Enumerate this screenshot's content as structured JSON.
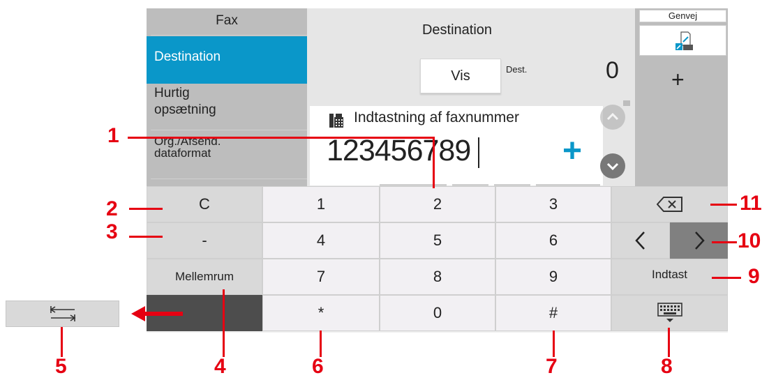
{
  "left_menu": {
    "title": "Fax",
    "items": [
      {
        "label": "Destination",
        "selected": true
      },
      {
        "label_line1": "Hurtig",
        "label_line2": "opsætning"
      },
      {
        "label_line1": "Org./Afsend.",
        "label_line2": "dataformat"
      }
    ]
  },
  "center": {
    "title": "Destination",
    "vis_button": "Vis",
    "dest_label": "Dest.",
    "dest_count": "0",
    "input_label": "Indtastning af faxnummer",
    "fax_number": "123456789",
    "add_symbol": "+"
  },
  "right": {
    "shortcut_label": "Genvej",
    "add_symbol": "+"
  },
  "keyboard": {
    "row1": [
      "C",
      "1",
      "2",
      "3"
    ],
    "row2": [
      "-",
      "4",
      "5",
      "6"
    ],
    "row3": [
      "Mellemrum",
      "7",
      "8",
      "9",
      "Indtast"
    ],
    "row4": [
      "*",
      "0",
      "#"
    ]
  },
  "callouts": [
    "1",
    "2",
    "3",
    "4",
    "5",
    "6",
    "7",
    "8",
    "9",
    "10",
    "11"
  ],
  "colors": {
    "accent": "#0a97c9",
    "callout": "#e60012"
  }
}
